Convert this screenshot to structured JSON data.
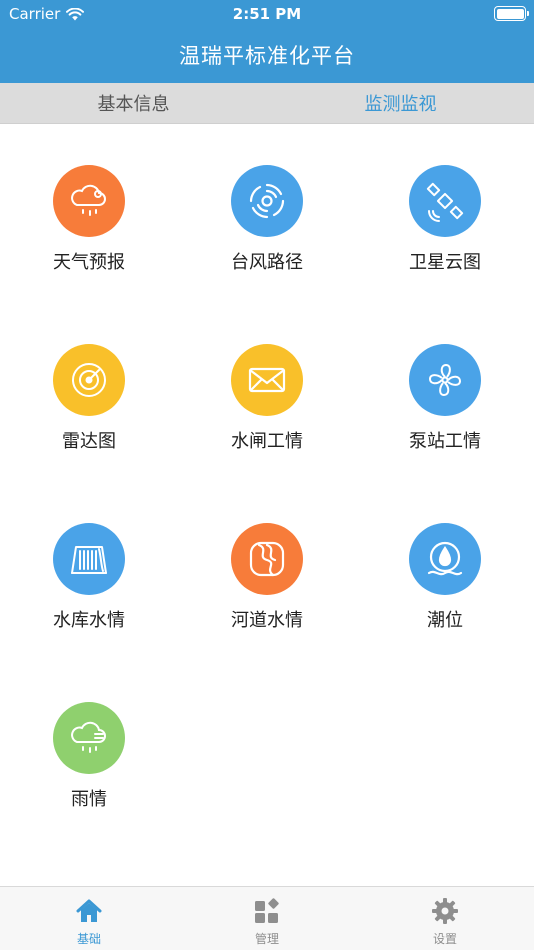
{
  "status": {
    "carrier": "Carrier",
    "time": "2:51 PM"
  },
  "header": {
    "title": "温瑞平标准化平台"
  },
  "segments": [
    {
      "label": "基本信息",
      "active": false
    },
    {
      "label": "监测监视",
      "active": true
    }
  ],
  "grid": [
    {
      "label": "天气预报",
      "icon": "weather-cloud-rain-icon",
      "color": "#f77c3a"
    },
    {
      "label": "台风路径",
      "icon": "typhoon-icon",
      "color": "#4aa3e8"
    },
    {
      "label": "卫星云图",
      "icon": "satellite-icon",
      "color": "#4aa3e8"
    },
    {
      "label": "雷达图",
      "icon": "radar-icon",
      "color": "#f9c02a"
    },
    {
      "label": "水闸工情",
      "icon": "envelope-icon",
      "color": "#f9c02a"
    },
    {
      "label": "泵站工情",
      "icon": "fan-icon",
      "color": "#4aa3e8"
    },
    {
      "label": "水库水情",
      "icon": "reservoir-icon",
      "color": "#4aa3e8"
    },
    {
      "label": "河道水情",
      "icon": "river-icon",
      "color": "#f77c3a"
    },
    {
      "label": "潮位",
      "icon": "water-drop-icon",
      "color": "#4aa3e8"
    },
    {
      "label": "雨情",
      "icon": "rain-cloud-icon",
      "color": "#8fd06e"
    }
  ],
  "tabbar": [
    {
      "label": "基础",
      "icon": "home-icon",
      "active": true
    },
    {
      "label": "管理",
      "icon": "grid-squares-icon",
      "active": false
    },
    {
      "label": "设置",
      "icon": "gear-icon",
      "active": false
    }
  ],
  "colors": {
    "primary": "#3b98d4",
    "segment_bg": "#dcdcdc",
    "tab_inactive": "#8e8e8e"
  }
}
